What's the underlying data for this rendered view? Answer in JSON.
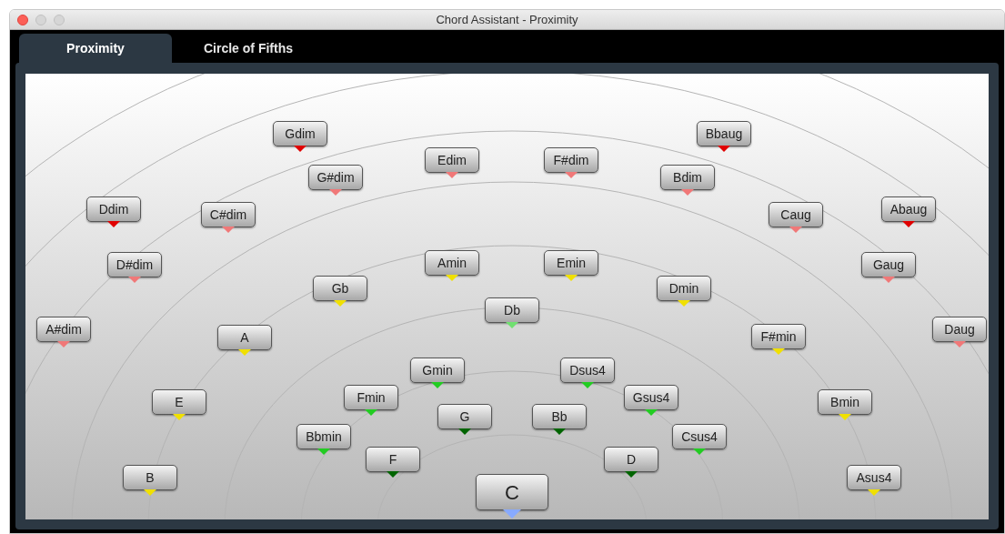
{
  "window": {
    "title": "Chord Assistant - Proximity"
  },
  "tabs": [
    {
      "label": "Proximity",
      "selected": true
    },
    {
      "label": "Circle of Fifths",
      "selected": false
    }
  ],
  "chords": [
    {
      "label": "Gdim",
      "color": "#e00000",
      "kind": "chord"
    },
    {
      "label": "Bbaug",
      "color": "#e00000",
      "kind": "chord"
    },
    {
      "label": "Edim",
      "color": "#f07878",
      "kind": "chord"
    },
    {
      "label": "F#dim",
      "color": "#f07878",
      "kind": "chord"
    },
    {
      "label": "G#dim",
      "color": "#f07878",
      "kind": "chord"
    },
    {
      "label": "Bdim",
      "color": "#f07878",
      "kind": "chord"
    },
    {
      "label": "Ddim",
      "color": "#e00000",
      "kind": "chord"
    },
    {
      "label": "C#dim",
      "color": "#f07878",
      "kind": "chord"
    },
    {
      "label": "Caug",
      "color": "#f07878",
      "kind": "chord"
    },
    {
      "label": "Abaug",
      "color": "#e00000",
      "kind": "chord"
    },
    {
      "label": "D#dim",
      "color": "#f07878",
      "kind": "chord"
    },
    {
      "label": "Amin",
      "color": "#f0e000",
      "kind": "chord"
    },
    {
      "label": "Emin",
      "color": "#f0e000",
      "kind": "chord"
    },
    {
      "label": "Gaug",
      "color": "#f07878",
      "kind": "chord"
    },
    {
      "label": "Gb",
      "color": "#f0e000",
      "kind": "chord"
    },
    {
      "label": "Dmin",
      "color": "#f0e000",
      "kind": "chord"
    },
    {
      "label": "Db",
      "color": "#70e070",
      "kind": "chord"
    },
    {
      "label": "A#dim",
      "color": "#f07878",
      "kind": "chord"
    },
    {
      "label": "A",
      "color": "#f0e000",
      "kind": "chord"
    },
    {
      "label": "F#min",
      "color": "#f0e000",
      "kind": "chord"
    },
    {
      "label": "Daug",
      "color": "#f07878",
      "kind": "chord"
    },
    {
      "label": "Gmin",
      "color": "#22cc22",
      "kind": "chord"
    },
    {
      "label": "Dsus4",
      "color": "#22cc22",
      "kind": "chord"
    },
    {
      "label": "E",
      "color": "#f0e000",
      "kind": "chord"
    },
    {
      "label": "Fmin",
      "color": "#22cc22",
      "kind": "chord"
    },
    {
      "label": "Gsus4",
      "color": "#22cc22",
      "kind": "chord"
    },
    {
      "label": "Bmin",
      "color": "#f0e000",
      "kind": "chord"
    },
    {
      "label": "G",
      "color": "#006400",
      "kind": "chord"
    },
    {
      "label": "Bb",
      "color": "#006400",
      "kind": "chord"
    },
    {
      "label": "Bbmin",
      "color": "#22cc22",
      "kind": "chord"
    },
    {
      "label": "Csus4",
      "color": "#22cc22",
      "kind": "chord"
    },
    {
      "label": "F",
      "color": "#006400",
      "kind": "chord"
    },
    {
      "label": "D",
      "color": "#006400",
      "kind": "chord"
    },
    {
      "label": "B",
      "color": "#f0e000",
      "kind": "chord"
    },
    {
      "label": "C",
      "color": "#88aaff",
      "kind": "root"
    },
    {
      "label": "Asus4",
      "color": "#f0e000",
      "kind": "chord"
    }
  ]
}
